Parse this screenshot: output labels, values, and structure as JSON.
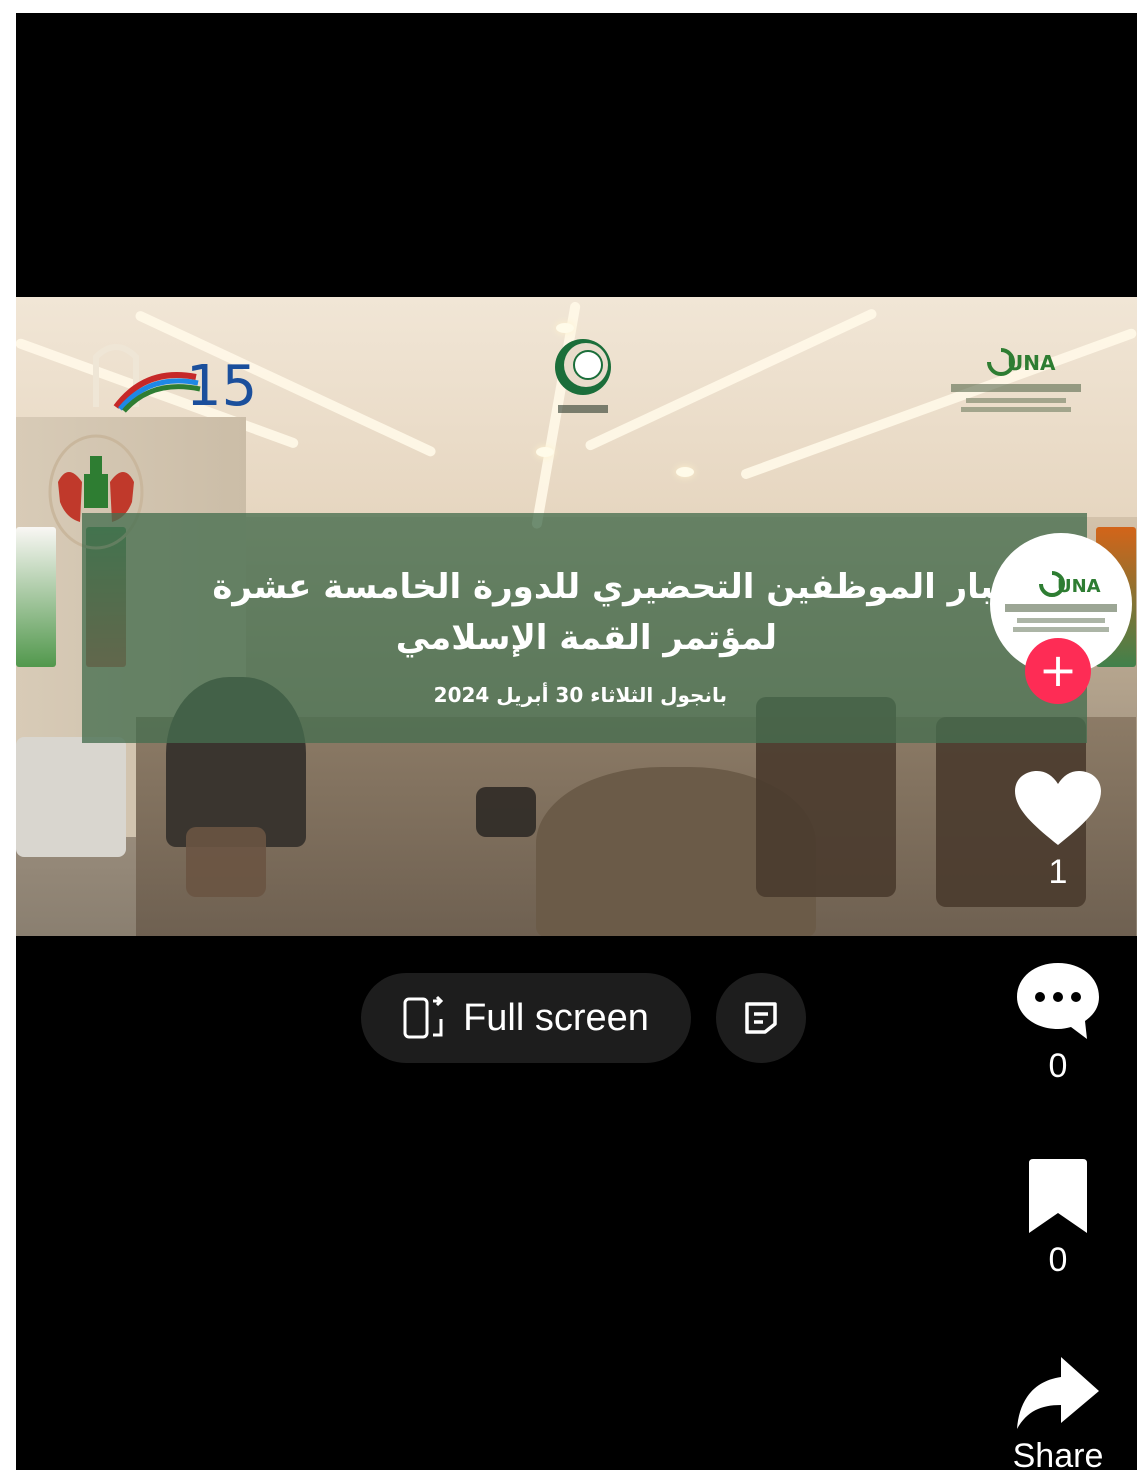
{
  "video": {
    "title_line1": "تماع كبار الموظفين التحضيري للدورة الخامسة عشرة",
    "title_line2": "لمؤتمر القمة الإسلامي",
    "subtitle": "بانجول الثلاثاء 30 أبريل 2024",
    "logo_left_text": "15",
    "logo_right_text": "UNA"
  },
  "actions": {
    "like_count": "1",
    "comment_count": "0",
    "save_count": "0",
    "share_label": "Share"
  },
  "controls": {
    "fullscreen_label": "Full screen"
  },
  "colors": {
    "follow": "#fe2c55",
    "banner": "#466e50",
    "button_bg": "#1d1d1d"
  },
  "icons": [
    "rotate-screen-icon",
    "more-icon",
    "heart-icon",
    "comment-icon",
    "bookmark-icon",
    "share-arrow-icon",
    "plus-icon"
  ]
}
